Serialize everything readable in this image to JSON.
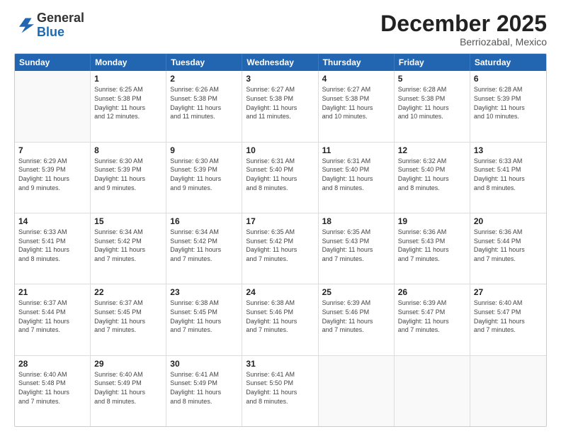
{
  "header": {
    "logo_general": "General",
    "logo_blue": "Blue",
    "month": "December 2025",
    "location": "Berriozabal, Mexico"
  },
  "weekdays": [
    "Sunday",
    "Monday",
    "Tuesday",
    "Wednesday",
    "Thursday",
    "Friday",
    "Saturday"
  ],
  "rows": [
    [
      {
        "day": "",
        "info": ""
      },
      {
        "day": "1",
        "info": "Sunrise: 6:25 AM\nSunset: 5:38 PM\nDaylight: 11 hours\nand 12 minutes."
      },
      {
        "day": "2",
        "info": "Sunrise: 6:26 AM\nSunset: 5:38 PM\nDaylight: 11 hours\nand 11 minutes."
      },
      {
        "day": "3",
        "info": "Sunrise: 6:27 AM\nSunset: 5:38 PM\nDaylight: 11 hours\nand 11 minutes."
      },
      {
        "day": "4",
        "info": "Sunrise: 6:27 AM\nSunset: 5:38 PM\nDaylight: 11 hours\nand 10 minutes."
      },
      {
        "day": "5",
        "info": "Sunrise: 6:28 AM\nSunset: 5:38 PM\nDaylight: 11 hours\nand 10 minutes."
      },
      {
        "day": "6",
        "info": "Sunrise: 6:28 AM\nSunset: 5:39 PM\nDaylight: 11 hours\nand 10 minutes."
      }
    ],
    [
      {
        "day": "7",
        "info": "Sunrise: 6:29 AM\nSunset: 5:39 PM\nDaylight: 11 hours\nand 9 minutes."
      },
      {
        "day": "8",
        "info": "Sunrise: 6:30 AM\nSunset: 5:39 PM\nDaylight: 11 hours\nand 9 minutes."
      },
      {
        "day": "9",
        "info": "Sunrise: 6:30 AM\nSunset: 5:39 PM\nDaylight: 11 hours\nand 9 minutes."
      },
      {
        "day": "10",
        "info": "Sunrise: 6:31 AM\nSunset: 5:40 PM\nDaylight: 11 hours\nand 8 minutes."
      },
      {
        "day": "11",
        "info": "Sunrise: 6:31 AM\nSunset: 5:40 PM\nDaylight: 11 hours\nand 8 minutes."
      },
      {
        "day": "12",
        "info": "Sunrise: 6:32 AM\nSunset: 5:40 PM\nDaylight: 11 hours\nand 8 minutes."
      },
      {
        "day": "13",
        "info": "Sunrise: 6:33 AM\nSunset: 5:41 PM\nDaylight: 11 hours\nand 8 minutes."
      }
    ],
    [
      {
        "day": "14",
        "info": "Sunrise: 6:33 AM\nSunset: 5:41 PM\nDaylight: 11 hours\nand 8 minutes."
      },
      {
        "day": "15",
        "info": "Sunrise: 6:34 AM\nSunset: 5:42 PM\nDaylight: 11 hours\nand 7 minutes."
      },
      {
        "day": "16",
        "info": "Sunrise: 6:34 AM\nSunset: 5:42 PM\nDaylight: 11 hours\nand 7 minutes."
      },
      {
        "day": "17",
        "info": "Sunrise: 6:35 AM\nSunset: 5:42 PM\nDaylight: 11 hours\nand 7 minutes."
      },
      {
        "day": "18",
        "info": "Sunrise: 6:35 AM\nSunset: 5:43 PM\nDaylight: 11 hours\nand 7 minutes."
      },
      {
        "day": "19",
        "info": "Sunrise: 6:36 AM\nSunset: 5:43 PM\nDaylight: 11 hours\nand 7 minutes."
      },
      {
        "day": "20",
        "info": "Sunrise: 6:36 AM\nSunset: 5:44 PM\nDaylight: 11 hours\nand 7 minutes."
      }
    ],
    [
      {
        "day": "21",
        "info": "Sunrise: 6:37 AM\nSunset: 5:44 PM\nDaylight: 11 hours\nand 7 minutes."
      },
      {
        "day": "22",
        "info": "Sunrise: 6:37 AM\nSunset: 5:45 PM\nDaylight: 11 hours\nand 7 minutes."
      },
      {
        "day": "23",
        "info": "Sunrise: 6:38 AM\nSunset: 5:45 PM\nDaylight: 11 hours\nand 7 minutes."
      },
      {
        "day": "24",
        "info": "Sunrise: 6:38 AM\nSunset: 5:46 PM\nDaylight: 11 hours\nand 7 minutes."
      },
      {
        "day": "25",
        "info": "Sunrise: 6:39 AM\nSunset: 5:46 PM\nDaylight: 11 hours\nand 7 minutes."
      },
      {
        "day": "26",
        "info": "Sunrise: 6:39 AM\nSunset: 5:47 PM\nDaylight: 11 hours\nand 7 minutes."
      },
      {
        "day": "27",
        "info": "Sunrise: 6:40 AM\nSunset: 5:47 PM\nDaylight: 11 hours\nand 7 minutes."
      }
    ],
    [
      {
        "day": "28",
        "info": "Sunrise: 6:40 AM\nSunset: 5:48 PM\nDaylight: 11 hours\nand 7 minutes."
      },
      {
        "day": "29",
        "info": "Sunrise: 6:40 AM\nSunset: 5:49 PM\nDaylight: 11 hours\nand 8 minutes."
      },
      {
        "day": "30",
        "info": "Sunrise: 6:41 AM\nSunset: 5:49 PM\nDaylight: 11 hours\nand 8 minutes."
      },
      {
        "day": "31",
        "info": "Sunrise: 6:41 AM\nSunset: 5:50 PM\nDaylight: 11 hours\nand 8 minutes."
      },
      {
        "day": "",
        "info": ""
      },
      {
        "day": "",
        "info": ""
      },
      {
        "day": "",
        "info": ""
      }
    ]
  ]
}
